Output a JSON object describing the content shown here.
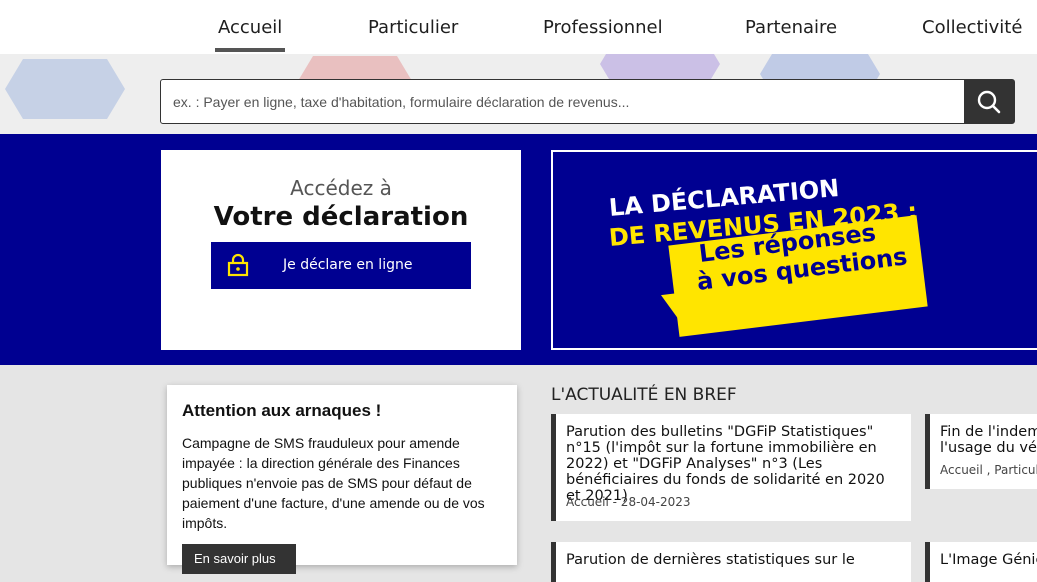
{
  "nav": {
    "items": [
      {
        "label": "Accueil"
      },
      {
        "label": "Particulier"
      },
      {
        "label": "Professionnel"
      },
      {
        "label": "Partenaire"
      },
      {
        "label": "Collectivité"
      }
    ]
  },
  "search": {
    "placeholder": "ex. : Payer en ligne, taxe d'habitation, formulaire déclaration de revenus...",
    "button_icon": "search-icon"
  },
  "declaration": {
    "subtitle": "Accédez à",
    "title": "Votre déclaration",
    "button_label": "Je déclare en ligne",
    "button_icon": "lock-icon"
  },
  "banner": {
    "line1": "LA DÉCLARATION",
    "line2": "DE REVENUS EN 2023 :",
    "highlight1": "Les réponses",
    "highlight2": "à vos questions"
  },
  "alert": {
    "title": "Attention aux arnaques !",
    "body": "Campagne de SMS frauduleux pour amende impayée : la direction générale des Finances publiques n'envoie pas de SMS pour défaut de paiement d'une facture, d'une amende ou de vos impôts.",
    "button_label": "En savoir plus"
  },
  "news": {
    "heading": "L'ACTUALITÉ EN BREF",
    "items": [
      {
        "title": "Parution des bulletins \"DGFiP Statistiques\" n°15 (l'impôt sur la fortune immobilière en 2022) et \"DGFiP Analyses\" n°3 (Les bénéficiaires du fonds de solidarité en 2020 et 2021)",
        "meta": "Accueil - 28-04-2023"
      },
      {
        "title": "Fin de l'indemnisation l'usage du véhicule",
        "meta": "Accueil , Particulier"
      },
      {
        "title": "Parution de dernières statistiques sur le",
        "meta": ""
      },
      {
        "title": "L'Image Génie",
        "meta": ""
      }
    ]
  },
  "colors": {
    "primary_blue": "#000091",
    "accent_yellow": "#ffe500",
    "dark": "#333333"
  }
}
